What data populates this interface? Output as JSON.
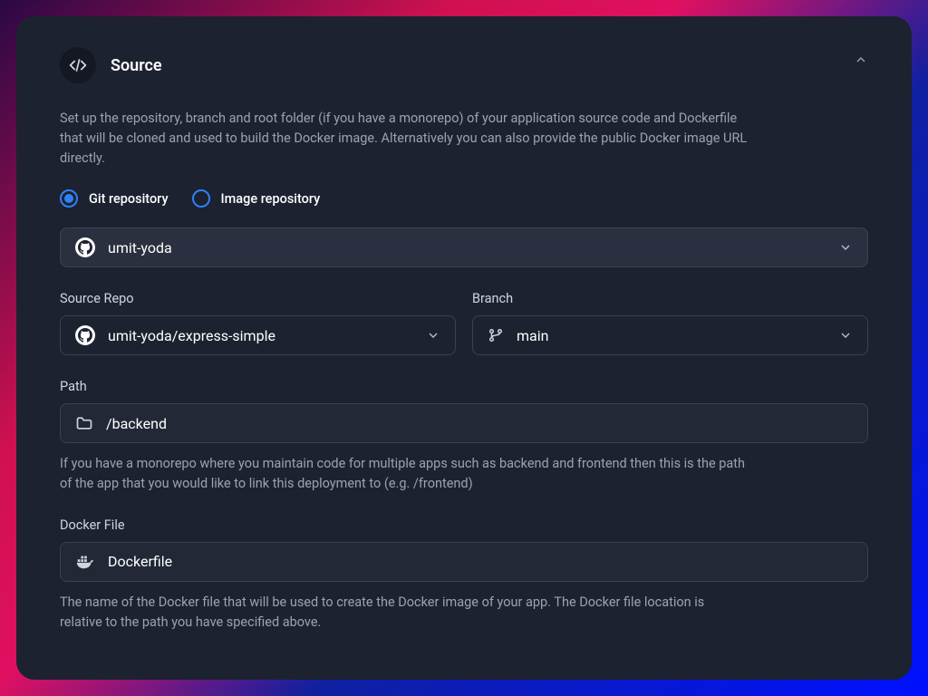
{
  "header": {
    "title": "Source"
  },
  "description": "Set up the repository, branch and root folder (if you have a monorepo) of your application source code and Dockerfile that will be cloned and used to build the Docker image. Alternatively you can also provide the public Docker image URL directly.",
  "source_type": {
    "options": [
      {
        "label": "Git repository",
        "selected": true
      },
      {
        "label": "Image repository",
        "selected": false
      }
    ]
  },
  "account": {
    "value": "umit-yoda"
  },
  "source_repo": {
    "label": "Source Repo",
    "value": "umit-yoda/express-simple"
  },
  "branch": {
    "label": "Branch",
    "value": "main"
  },
  "path": {
    "label": "Path",
    "value": "/backend",
    "help": "If you have a monorepo where you maintain code for multiple apps such as backend and frontend then this is the path of the app that you would like to link this deployment to (e.g. /frontend)"
  },
  "dockerfile": {
    "label": "Docker File",
    "value": "Dockerfile",
    "help": "The name of the Docker file that will be used to create the Docker image of your app. The Docker file location is relative to the path you have specified above."
  }
}
